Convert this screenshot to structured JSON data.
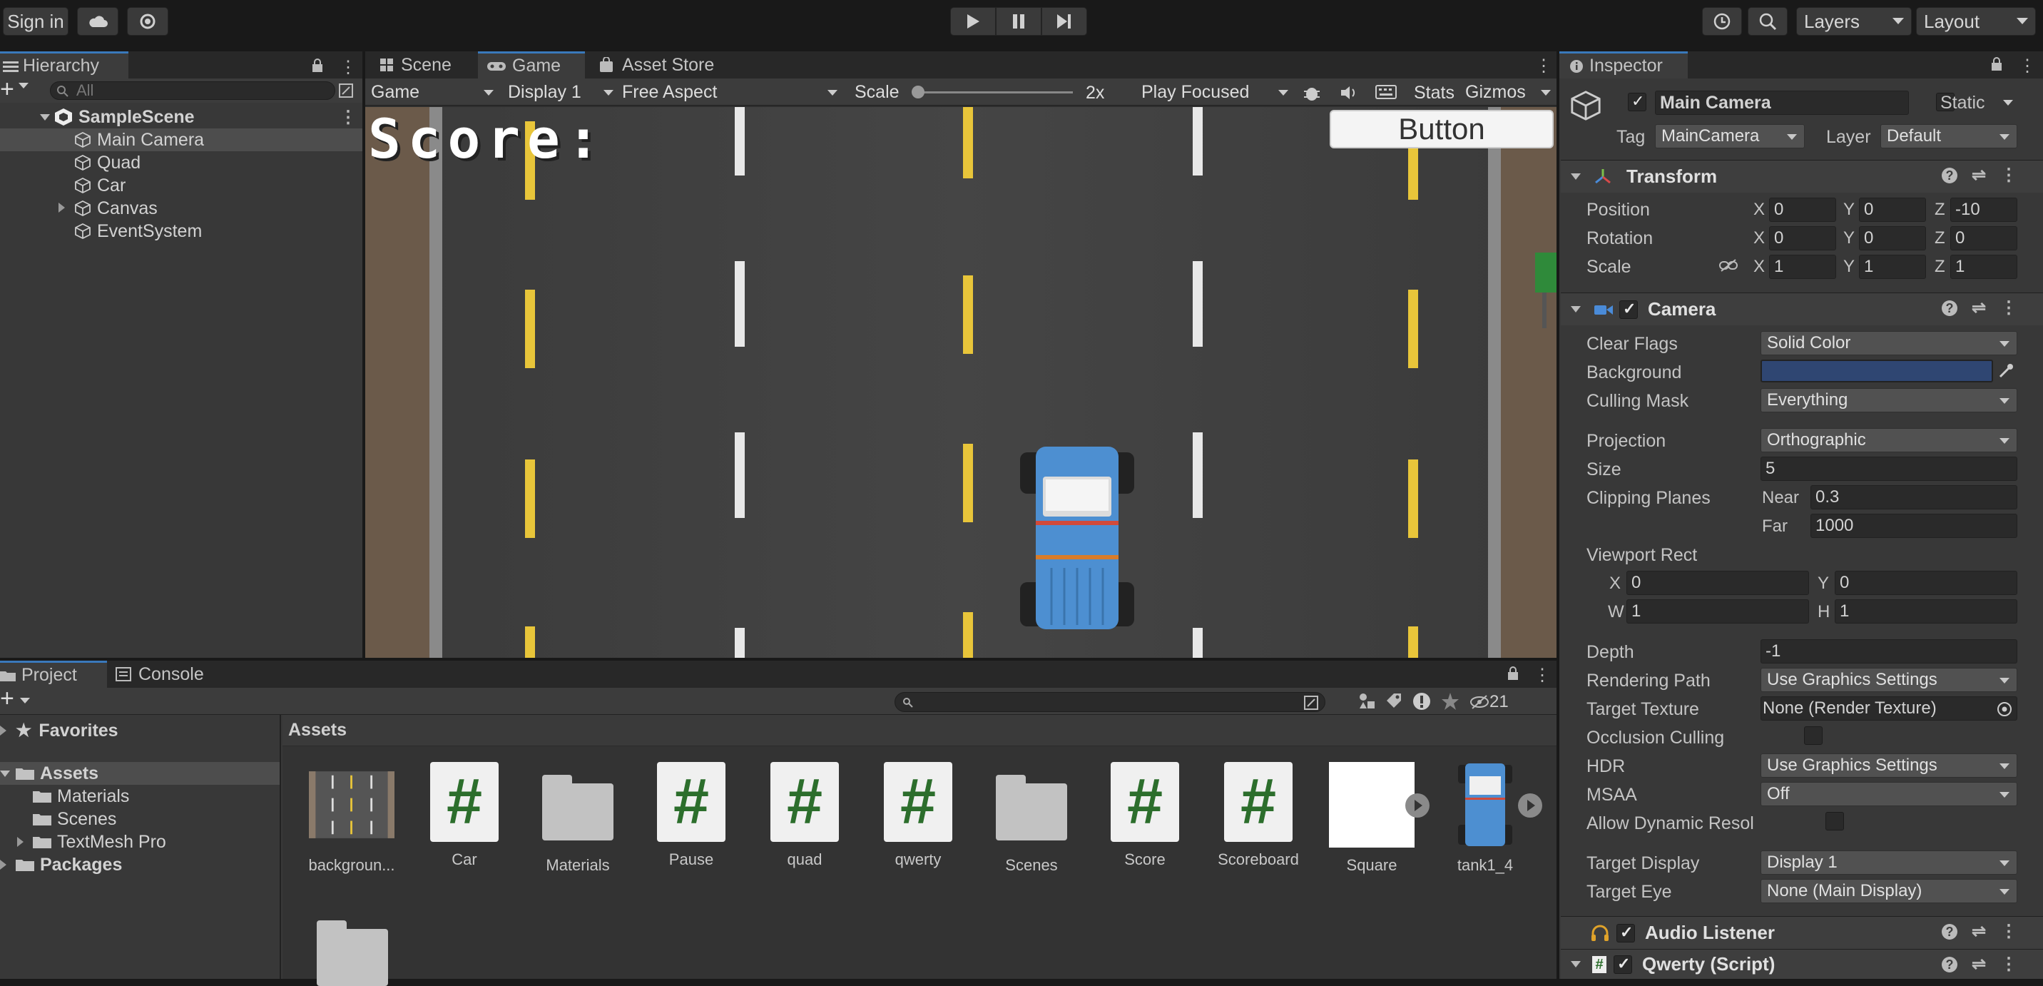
{
  "toolbar": {
    "sign_in": "Sign in",
    "layers": "Layers",
    "layout": "Layout"
  },
  "hierarchy": {
    "tab": "Hierarchy",
    "search_placeholder": "All",
    "scene": "SampleScene",
    "items": [
      "Main Camera",
      "Quad",
      "Car",
      "Canvas",
      "EventSystem"
    ]
  },
  "center_tabs": {
    "scene": "Scene",
    "game": "Game",
    "asset_store": "Asset Store"
  },
  "game_toolbar": {
    "mode": "Game",
    "display": "Display 1",
    "aspect": "Free Aspect",
    "scale_label": "Scale",
    "scale_value": "2x",
    "play_focus": "Play Focused",
    "stats": "Stats",
    "gizmos": "Gizmos"
  },
  "game_view": {
    "score_text": "Score:",
    "button_label": "Button"
  },
  "bottom_tabs": {
    "project": "Project",
    "console": "Console"
  },
  "project": {
    "favorites": "Favorites",
    "assets": "Assets",
    "folders": [
      "Materials",
      "Scenes",
      "TextMesh Pro"
    ],
    "packages": "Packages",
    "breadcrumb": "Assets",
    "hidden_count": "21",
    "asset_items": [
      {
        "name": "backgroun...",
        "kind": "texture"
      },
      {
        "name": "Car",
        "kind": "script"
      },
      {
        "name": "Materials",
        "kind": "folder"
      },
      {
        "name": "Pause",
        "kind": "script"
      },
      {
        "name": "quad",
        "kind": "script"
      },
      {
        "name": "qwerty",
        "kind": "script"
      },
      {
        "name": "Scenes",
        "kind": "folder"
      },
      {
        "name": "Score",
        "kind": "script"
      },
      {
        "name": "Scoreboard",
        "kind": "script"
      },
      {
        "name": "Square",
        "kind": "sprite"
      },
      {
        "name": "tank1_4",
        "kind": "sprite"
      }
    ]
  },
  "inspector": {
    "tab": "Inspector",
    "object_name": "Main Camera",
    "static_label": "Static",
    "tag_label": "Tag",
    "tag_value": "MainCamera",
    "layer_label": "Layer",
    "layer_value": "Default",
    "transform": {
      "title": "Transform",
      "position_label": "Position",
      "rotation_label": "Rotation",
      "scale_label": "Scale",
      "position": [
        "0",
        "0",
        "-10"
      ],
      "rotation": [
        "0",
        "0",
        "0"
      ],
      "scale": [
        "1",
        "1",
        "1"
      ]
    },
    "camera": {
      "title": "Camera",
      "clear_flags_label": "Clear Flags",
      "clear_flags": "Solid Color",
      "background_label": "Background",
      "background_color": "#2f4672",
      "culling_mask_label": "Culling Mask",
      "culling_mask": "Everything",
      "projection_label": "Projection",
      "projection": "Orthographic",
      "size_label": "Size",
      "size": "5",
      "clipping_label": "Clipping Planes",
      "near_label": "Near",
      "near": "0.3",
      "far_label": "Far",
      "far": "1000",
      "viewport_label": "Viewport Rect",
      "vx": "0",
      "vy": "0",
      "vw": "1",
      "vh": "1",
      "depth_label": "Depth",
      "depth": "-1",
      "rendering_path_label": "Rendering Path",
      "rendering_path": "Use Graphics Settings",
      "target_texture_label": "Target Texture",
      "target_texture": "None (Render Texture)",
      "occlusion_label": "Occlusion Culling",
      "hdr_label": "HDR",
      "hdr": "Use Graphics Settings",
      "msaa_label": "MSAA",
      "msaa": "Off",
      "dynamic_res_label": "Allow Dynamic Resol",
      "target_display_label": "Target Display",
      "target_display": "Display 1",
      "target_eye_label": "Target Eye",
      "target_eye": "None (Main Display)"
    },
    "audio_listener": "Audio Listener",
    "script_component": "Qwerty (Script)"
  }
}
